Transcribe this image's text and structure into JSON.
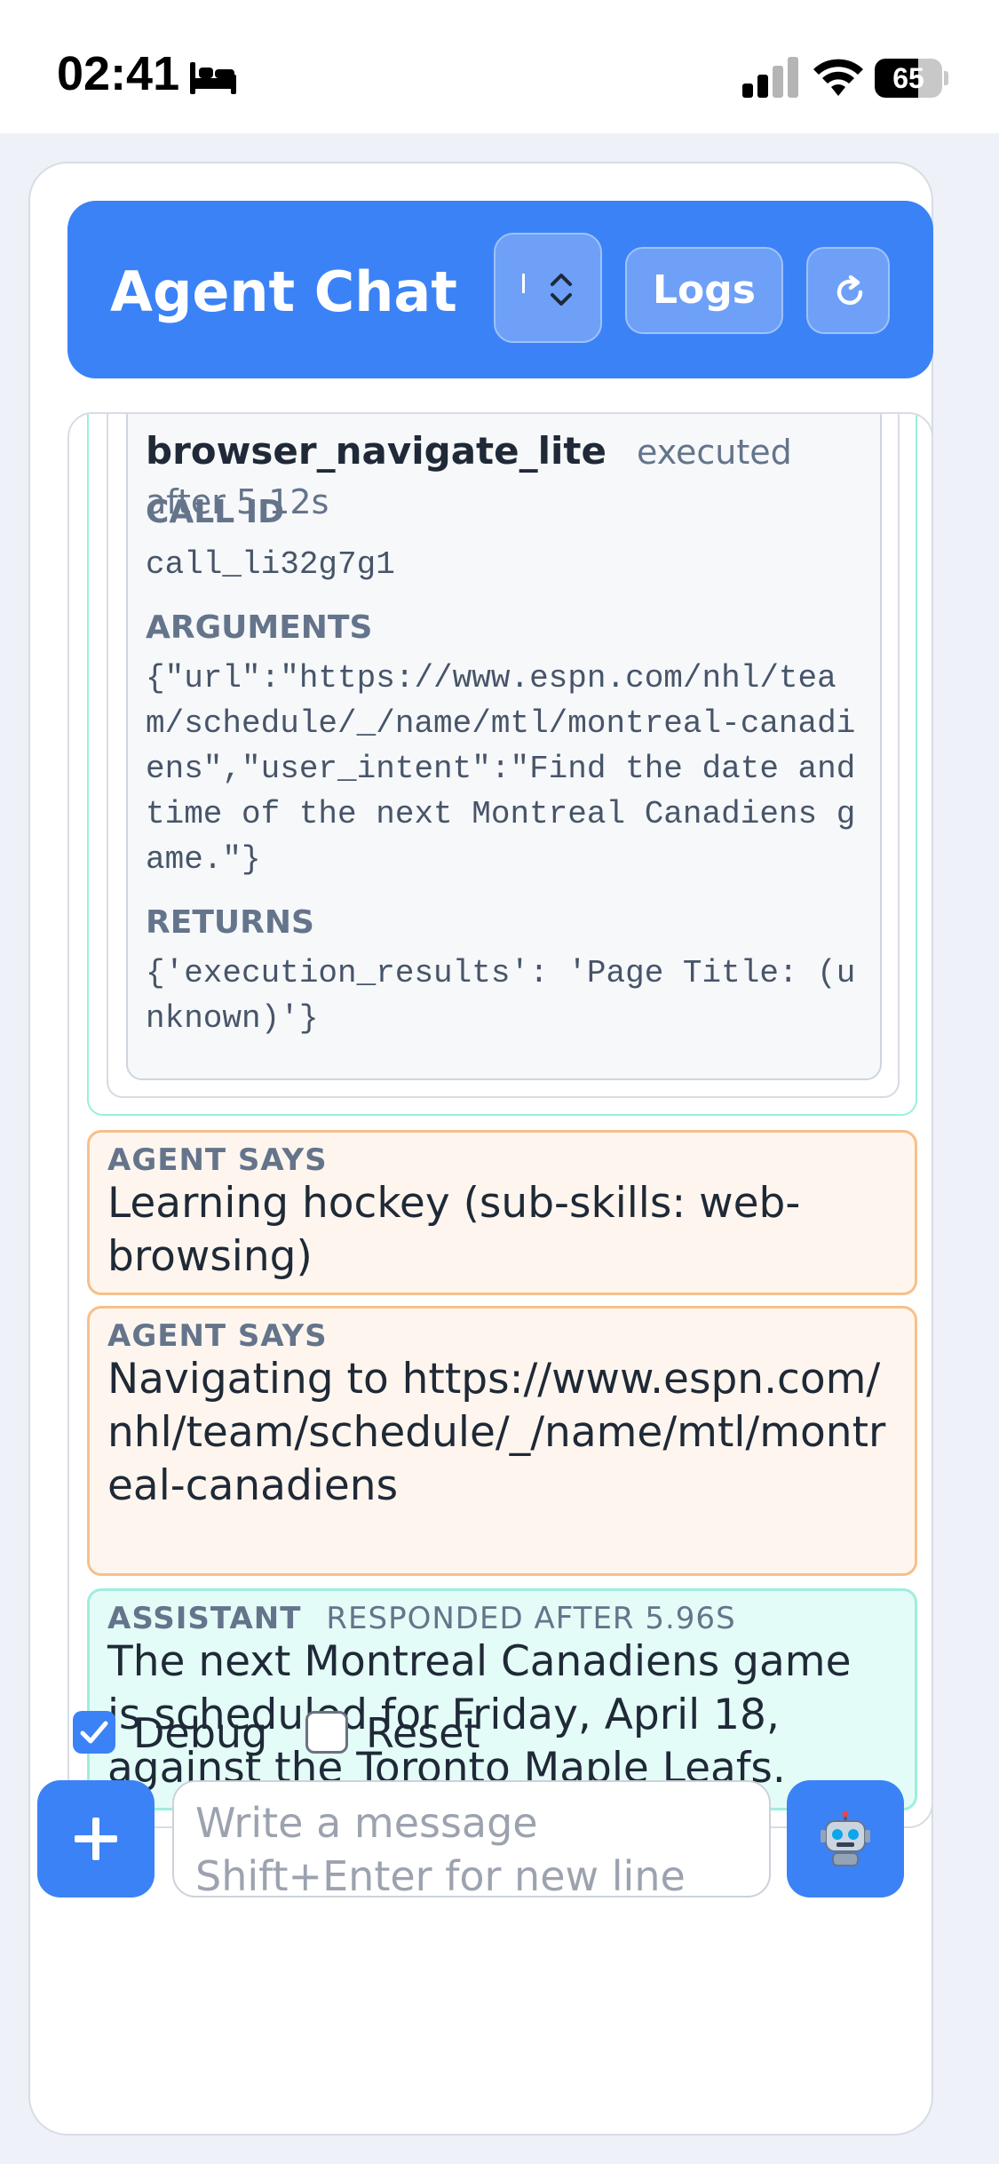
{
  "status_bar": {
    "time": "02:41",
    "battery": "65",
    "battery_level": 0.65,
    "icons": [
      "bed-icon",
      "signal-icon",
      "wifi-icon",
      "battery-icon"
    ]
  },
  "header": {
    "title": "Agent Chat",
    "logs_label": "Logs",
    "icons": [
      "chevron-updown-icon",
      "refresh-icon"
    ]
  },
  "tool_call": {
    "name": "browser_navigate_lite",
    "executed": "executed after 5.12s",
    "call_id_label": "CALL ID",
    "call_id": "call_li32g7g1",
    "arguments_label": "ARGUMENTS",
    "arguments": "{\"url\":\"https://www.espn.com/nhl/team/schedule/_/name/mtl/montreal-canadiens\",\"user_intent\":\"Find the date and time of the next Montreal Canadiens game.\"}",
    "returns_label": "RETURNS",
    "returns": "{'execution_results': 'Page Title: (unknown)'}"
  },
  "messages": [
    {
      "role": "AGENT SAYS",
      "text": "Learning hockey (sub-skills: web-browsing)"
    },
    {
      "role": "AGENT SAYS",
      "text": "Navigating to https://www.espn.com/nhl/team/schedule/_/name/mtl/montreal-canadiens"
    },
    {
      "role": "ASSISTANT",
      "meta": "RESPONDED AFTER 5.96S",
      "text": "The next Montreal Canadiens game is scheduled for Friday, April 18, against the Toronto Maple Leafs."
    }
  ],
  "controls": {
    "debug_label": "Debug",
    "reset_label": "Reset",
    "debug_checked": true,
    "reset_checked": false
  },
  "input": {
    "placeholder": "Write a message\nShift+Enter for new line"
  },
  "colors": {
    "accent": "#3b82f6",
    "agent_bg": "#fef6ee",
    "agent_border": "#f6c08a",
    "assistant_bg": "#e4fcf7",
    "assistant_border": "#9cefdc"
  }
}
